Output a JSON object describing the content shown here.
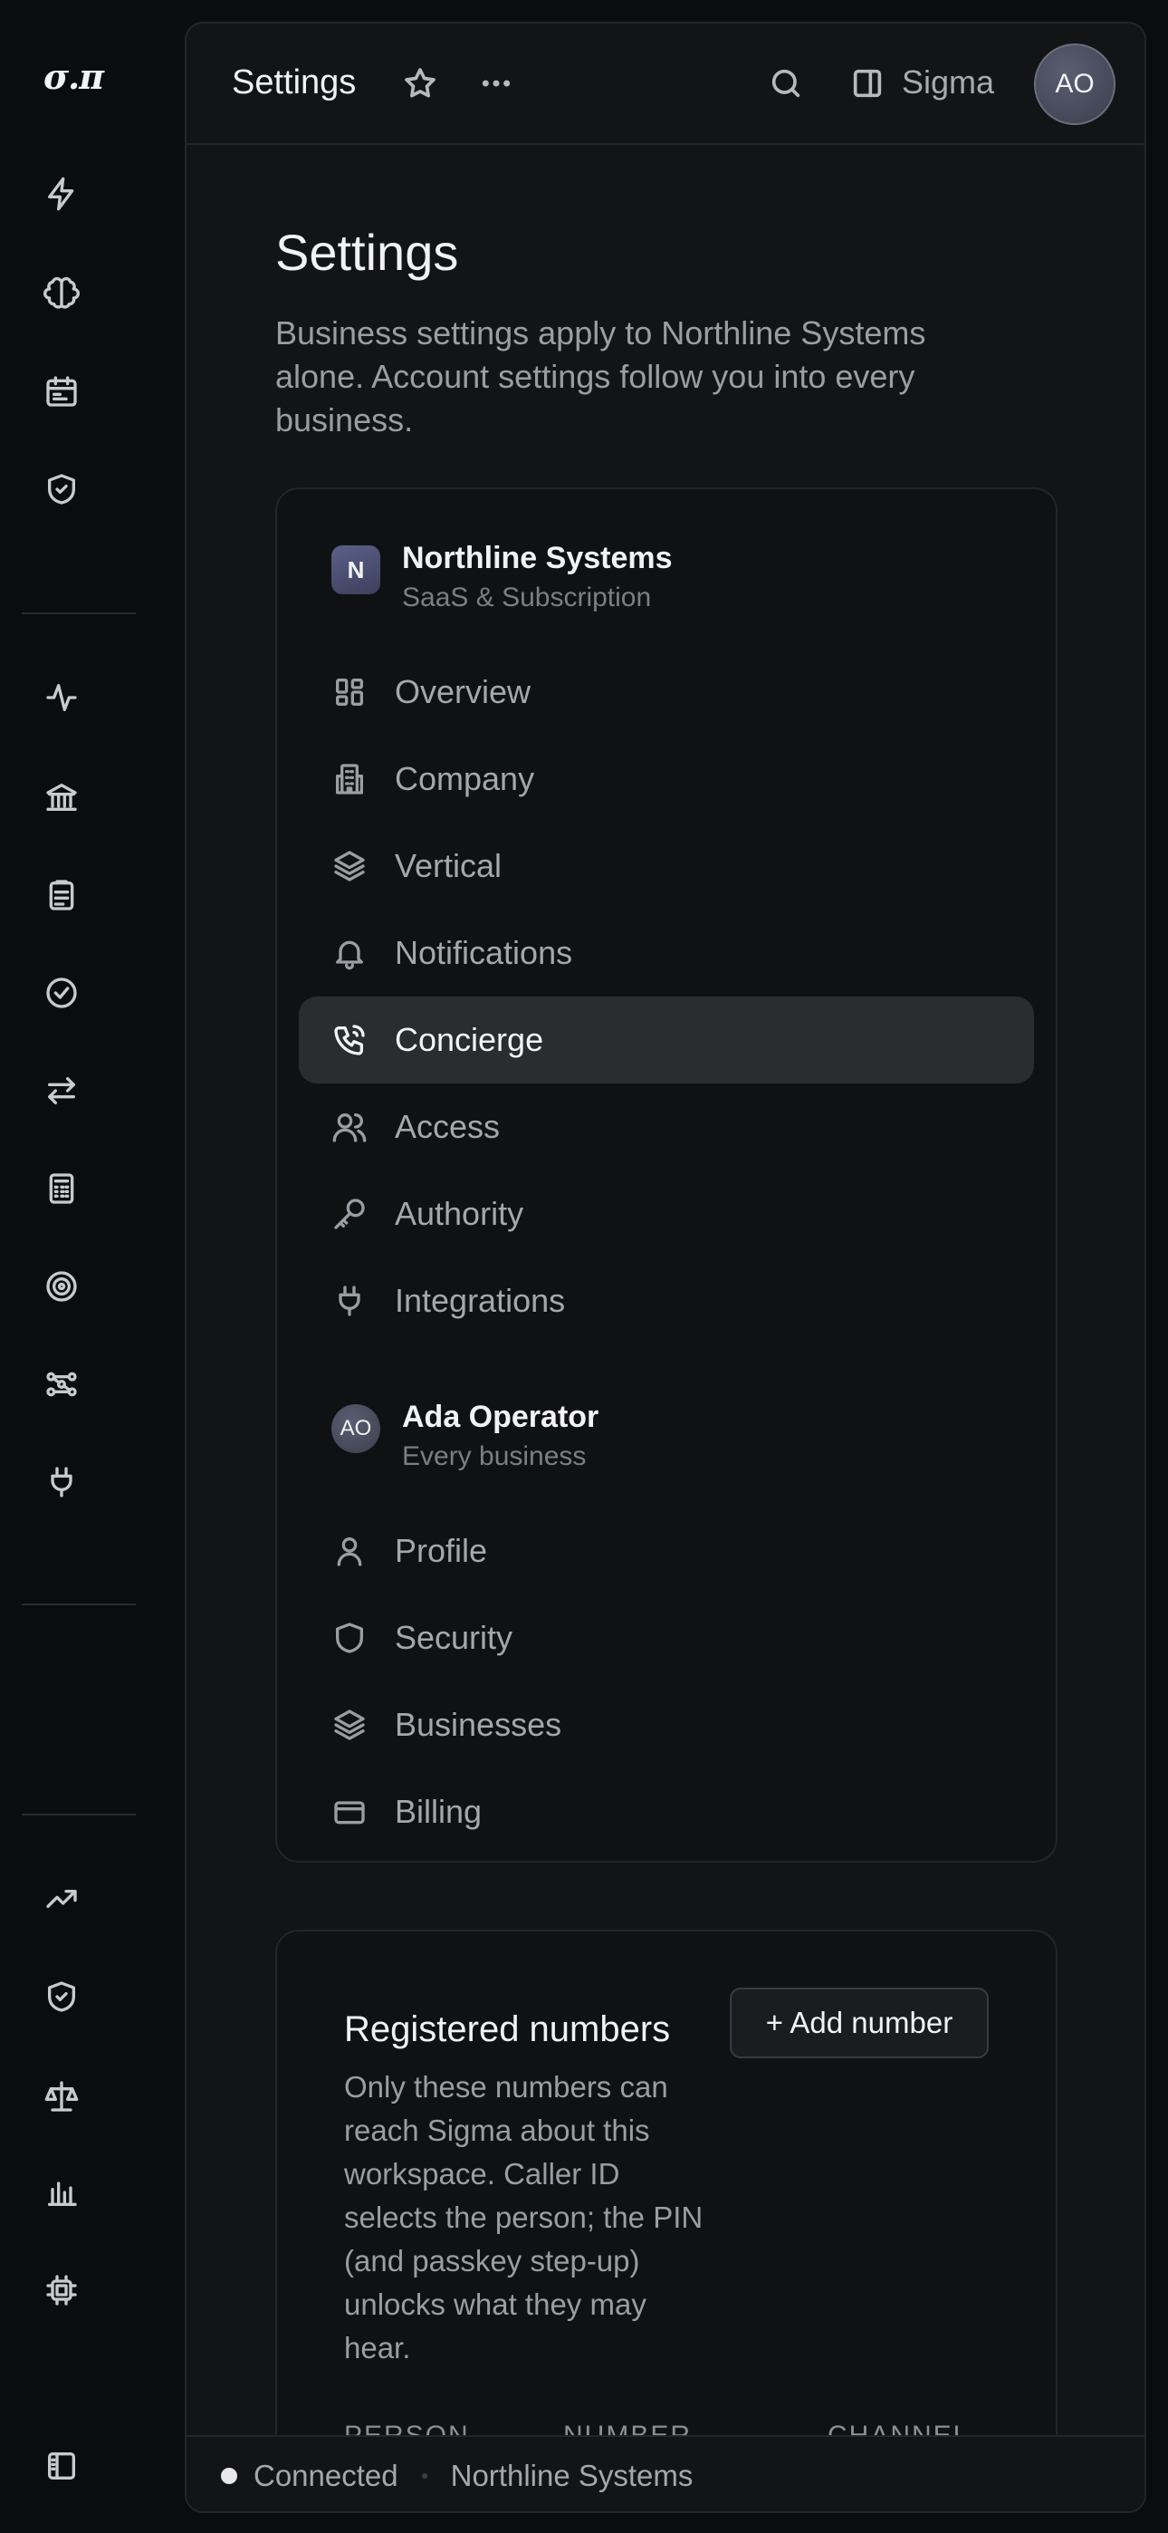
{
  "rail": {
    "logo": "σ.π",
    "icons_top": [
      "lightning-icon",
      "brain-icon",
      "calendar-icon",
      "shield-check-icon"
    ],
    "icons_mid": [
      "activity-icon",
      "bank-icon",
      "clipboard-icon",
      "badge-check-icon",
      "arrows-exchange-icon",
      "calculator-icon",
      "target-icon",
      "workflow-icon",
      "plug-icon"
    ],
    "icons_bottom": [
      "trending-up-icon",
      "shield-check-icon",
      "scale-icon",
      "bar-chart-icon",
      "cpu-icon"
    ],
    "footer_icon": "sidebar-toggle-icon"
  },
  "topbar": {
    "title": "Settings",
    "assistant": "Sigma",
    "avatar": "AO"
  },
  "page": {
    "title": "Settings",
    "description": "Business settings apply to Northline Systems alone. Account settings follow you into every business."
  },
  "business": {
    "badge": "N",
    "name": "Northline Systems",
    "subtitle": "SaaS & Subscription",
    "items": [
      {
        "label": "Overview",
        "icon": "grid-icon"
      },
      {
        "label": "Company",
        "icon": "building-icon"
      },
      {
        "label": "Vertical",
        "icon": "layers-icon"
      },
      {
        "label": "Notifications",
        "icon": "bell-icon"
      },
      {
        "label": "Concierge",
        "icon": "phone-icon",
        "active": true
      },
      {
        "label": "Access",
        "icon": "users-icon"
      },
      {
        "label": "Authority",
        "icon": "key-icon"
      },
      {
        "label": "Integrations",
        "icon": "plug-icon"
      }
    ]
  },
  "account": {
    "badge": "AO",
    "name": "Ada Operator",
    "subtitle": "Every business",
    "items": [
      {
        "label": "Profile",
        "icon": "user-icon"
      },
      {
        "label": "Security",
        "icon": "shield-icon"
      },
      {
        "label": "Businesses",
        "icon": "layers-icon"
      },
      {
        "label": "Billing",
        "icon": "credit-card-icon"
      }
    ]
  },
  "numbers": {
    "title": "Registered numbers",
    "description": "Only these numbers can reach Sigma about this workspace. Caller ID selects the person; the PIN (and passkey step-up) unlocks what they may hear.",
    "add_label": "+ Add number",
    "columns": [
      "PERSON",
      "NUMBER",
      "CHANNEL"
    ]
  },
  "status": {
    "state": "Connected",
    "workspace": "Northline Systems"
  }
}
